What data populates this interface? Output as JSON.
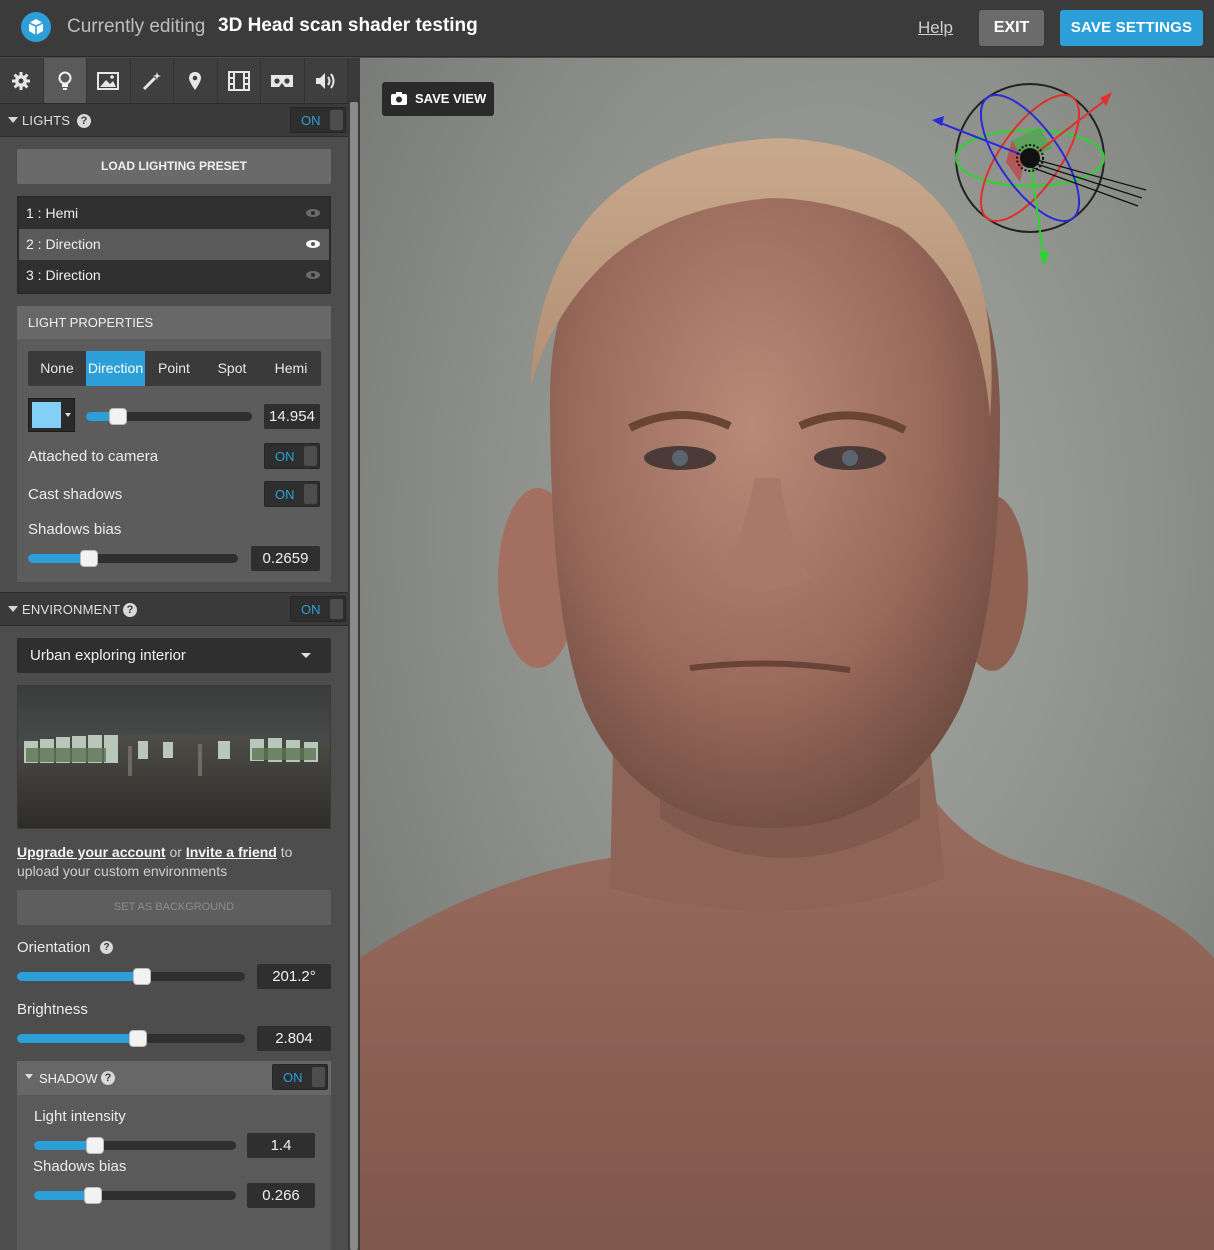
{
  "header": {
    "title_prefix": "Currently editing",
    "model_name": "3D Head scan shader testing",
    "help_label": "Help",
    "exit_label": "EXIT",
    "save_label": "SAVE SETTINGS"
  },
  "toolbar_tabs": [
    {
      "icon": "gear-icon"
    },
    {
      "icon": "lightbulb-icon"
    },
    {
      "icon": "image-icon"
    },
    {
      "icon": "magic-wand-icon"
    },
    {
      "icon": "map-pin-icon"
    },
    {
      "icon": "film-icon"
    },
    {
      "icon": "vr-headset-icon"
    },
    {
      "icon": "speaker-icon"
    }
  ],
  "lights": {
    "section_label": "LIGHTS",
    "toggle": "ON",
    "load_preset_label": "LOAD LIGHTING PRESET",
    "items": [
      {
        "label": "1 : Hemi"
      },
      {
        "label": "2 : Direction"
      },
      {
        "label": "3 : Direction"
      }
    ],
    "properties_title": "LIGHT PROPERTIES",
    "types": [
      "None",
      "Direction",
      "Point",
      "Spot",
      "Hemi"
    ],
    "selected_type": "Direction",
    "color": "#84cff5",
    "intensity": "14.954",
    "intensity_fraction": 0.19,
    "attached_label": "Attached to camera",
    "attached_toggle": "ON",
    "cast_shadows_label": "Cast shadows",
    "cast_shadows_toggle": "ON",
    "shadows_bias_label": "Shadows bias",
    "shadows_bias_value": "0.2659",
    "shadows_bias_fraction": 0.29
  },
  "environment": {
    "section_label": "ENVIRONMENT",
    "toggle": "ON",
    "selected_env": "Urban exploring interior",
    "upgrade_link": "Upgrade your account",
    "or_text": "or",
    "invite_link": "Invite a friend",
    "to_text": "to",
    "upload_text": "upload your custom environments",
    "set_bg_label": "SET AS BACKGROUND",
    "orientation_label": "Orientation",
    "orientation_value": "201.2°",
    "orientation_fraction": 0.55,
    "brightness_label": "Brightness",
    "brightness_value": "2.804",
    "brightness_fraction": 0.53,
    "shadow": {
      "label": "SHADOW",
      "toggle": "ON",
      "light_intensity_label": "Light intensity",
      "light_intensity_value": "1.4",
      "light_intensity_fraction": 0.3,
      "shadows_bias_label": "Shadows bias",
      "shadows_bias_value": "0.266",
      "shadows_bias_fraction": 0.29
    }
  },
  "viewport": {
    "save_view_label": "SAVE VIEW"
  },
  "colors": {
    "accent": "#2d9fd8",
    "panel": "#4d4d4d",
    "topbar": "#3b3b3b"
  }
}
